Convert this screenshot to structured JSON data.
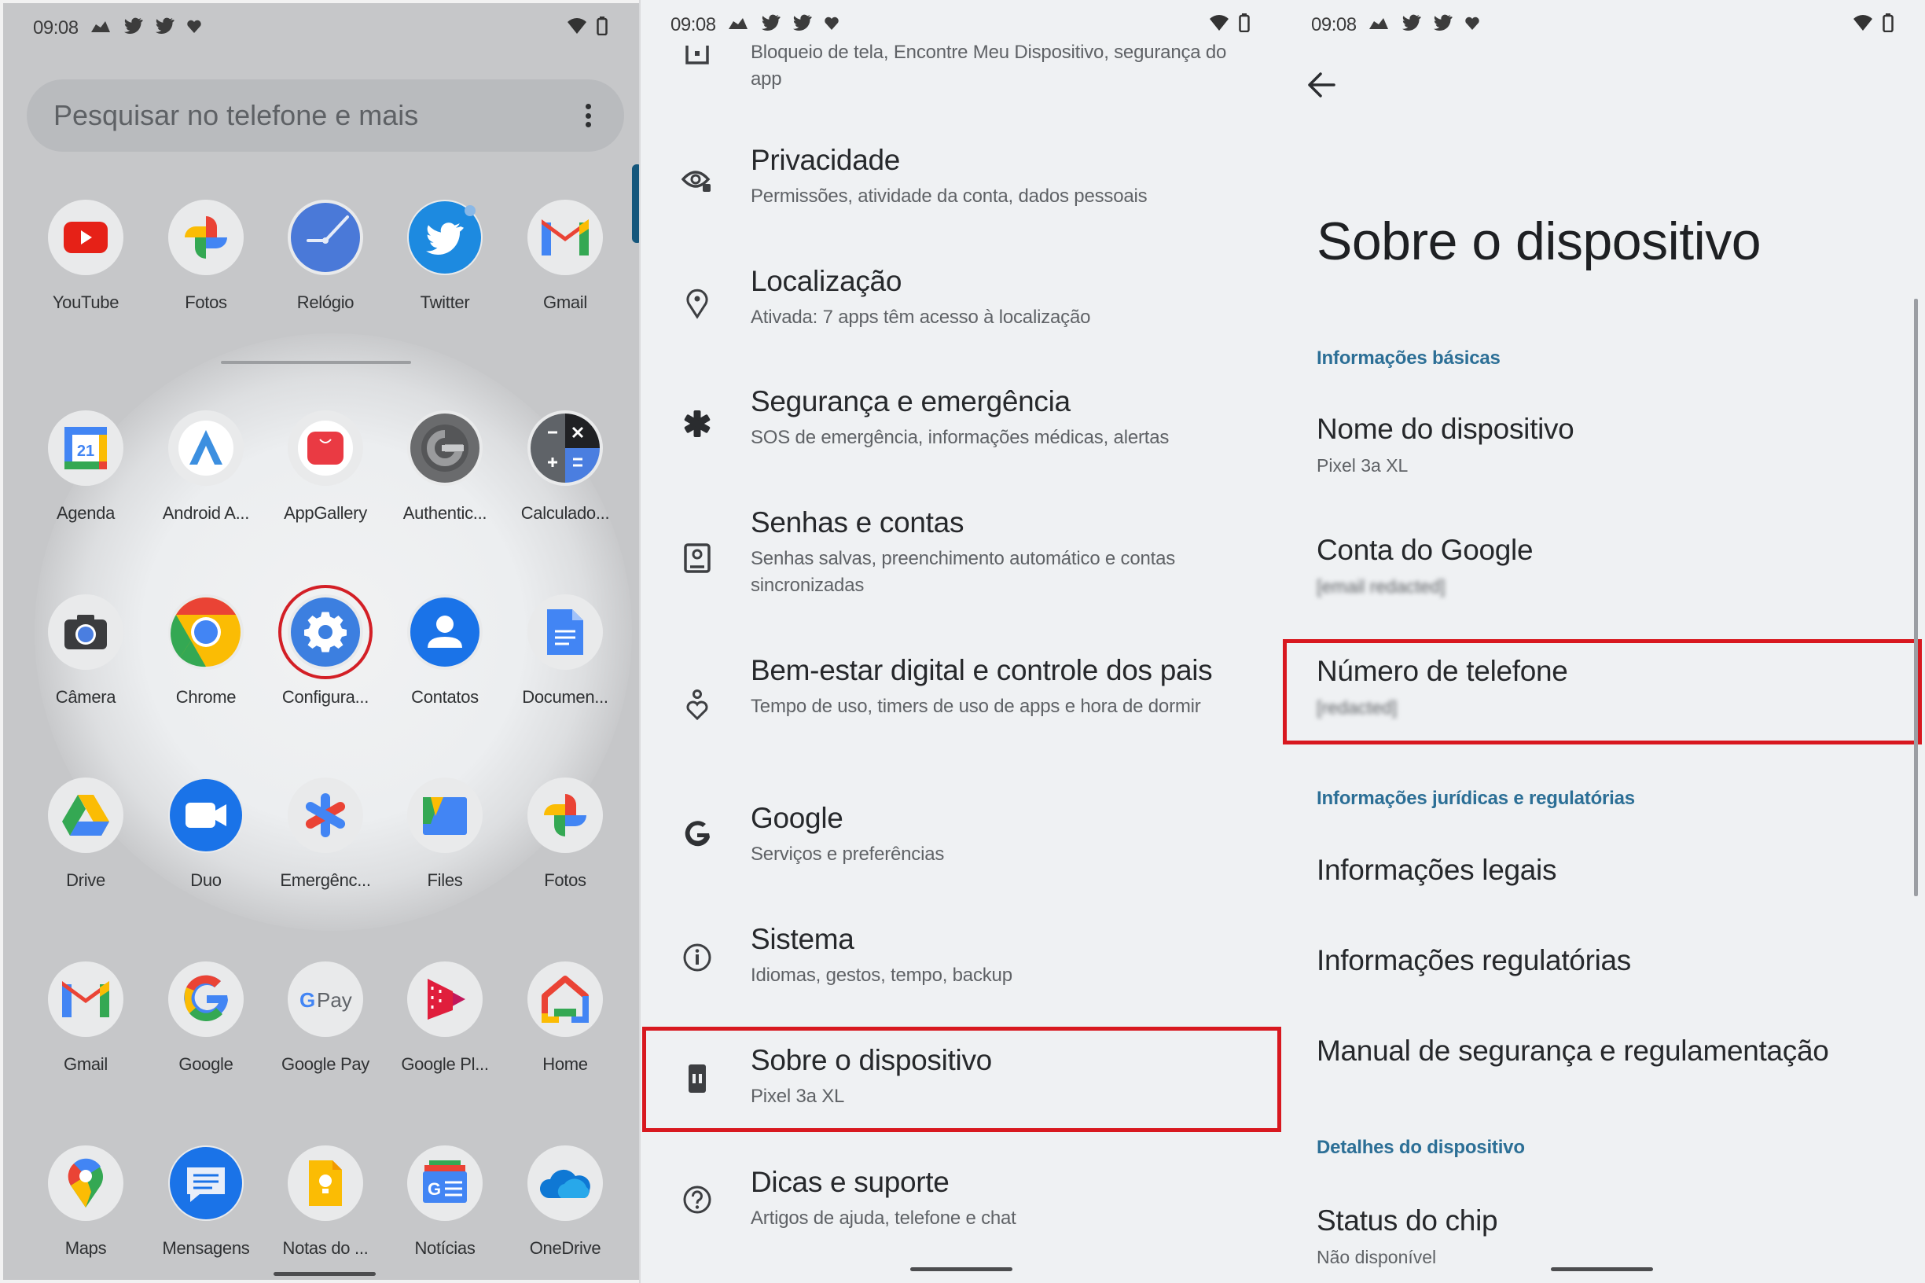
{
  "status_bar": {
    "time": "09:08",
    "icons": [
      "cloud-icon",
      "twitter-icon",
      "twitter-icon",
      "heart-shield-icon"
    ],
    "right_icons": [
      "wifi-icon",
      "battery-icon"
    ]
  },
  "drawer": {
    "search_placeholder": "Pesquisar no telefone e mais",
    "apps": [
      {
        "label": "YouTube",
        "icon": "youtube-icon"
      },
      {
        "label": "Fotos",
        "icon": "google-photos-icon"
      },
      {
        "label": "Relógio",
        "icon": "clock-icon"
      },
      {
        "label": "Twitter",
        "icon": "twitter-icon"
      },
      {
        "label": "Gmail",
        "icon": "gmail-icon"
      },
      {
        "label": "Agenda",
        "icon": "calendar-icon"
      },
      {
        "label": "Android A...",
        "icon": "android-auto-icon"
      },
      {
        "label": "AppGallery",
        "icon": "appgallery-icon"
      },
      {
        "label": "Authentic...",
        "icon": "authenticator-icon"
      },
      {
        "label": "Calculado...",
        "icon": "calculator-icon"
      },
      {
        "label": "Câmera",
        "icon": "camera-icon"
      },
      {
        "label": "Chrome",
        "icon": "chrome-icon"
      },
      {
        "label": "Configura...",
        "icon": "settings-gear-icon",
        "highlighted": true
      },
      {
        "label": "Contatos",
        "icon": "contacts-icon"
      },
      {
        "label": "Documen...",
        "icon": "docs-icon"
      },
      {
        "label": "Drive",
        "icon": "drive-icon"
      },
      {
        "label": "Duo",
        "icon": "duo-icon"
      },
      {
        "label": "Emergênc...",
        "icon": "emergency-icon"
      },
      {
        "label": "Files",
        "icon": "files-icon"
      },
      {
        "label": "Fotos",
        "icon": "google-photos-icon"
      },
      {
        "label": "Gmail",
        "icon": "gmail-icon"
      },
      {
        "label": "Google",
        "icon": "google-icon"
      },
      {
        "label": "Google Pay",
        "icon": "google-pay-icon"
      },
      {
        "label": "Google Pl...",
        "icon": "play-movies-icon"
      },
      {
        "label": "Home",
        "icon": "home-icon"
      },
      {
        "label": "Maps",
        "icon": "maps-icon"
      },
      {
        "label": "Mensagens",
        "icon": "messages-icon"
      },
      {
        "label": "Notas do ...",
        "icon": "keep-notes-icon"
      },
      {
        "label": "Notícias",
        "icon": "news-icon"
      },
      {
        "label": "OneDrive",
        "icon": "onedrive-icon"
      }
    ]
  },
  "settings": {
    "items": [
      {
        "title": "",
        "subtitle": "Bloqueio de tela, Encontre Meu Dispositivo, segurança do app",
        "icon": "security-lock-icon"
      },
      {
        "title": "Privacidade",
        "subtitle": "Permissões, atividade da conta, dados pessoais",
        "icon": "privacy-eye-icon"
      },
      {
        "title": "Localização",
        "subtitle": "Ativada: 7 apps têm acesso à localização",
        "icon": "location-pin-icon"
      },
      {
        "title": "Segurança e emergência",
        "subtitle": "SOS de emergência, informações médicas, alertas",
        "icon": "emergency-asterisk-icon"
      },
      {
        "title": "Senhas e contas",
        "subtitle": "Senhas salvas, preenchimento automático e contas sincronizadas",
        "icon": "account-box-icon"
      },
      {
        "title": "Bem-estar digital e controle dos pais",
        "subtitle": "Tempo de uso, timers de uso de apps e hora de dormir",
        "icon": "wellbeing-icon"
      },
      {
        "title": "Google",
        "subtitle": "Serviços e preferências",
        "icon": "google-g-icon"
      },
      {
        "title": "Sistema",
        "subtitle": "Idiomas, gestos, tempo, backup",
        "icon": "info-circle-icon"
      },
      {
        "title": "Sobre o dispositivo",
        "subtitle": "Pixel 3a XL",
        "icon": "phone-device-icon",
        "highlighted": true
      },
      {
        "title": "Dicas e suporte",
        "subtitle": "Artigos de ajuda, telefone e chat",
        "icon": "help-circle-icon"
      }
    ]
  },
  "about": {
    "title": "Sobre o dispositivo",
    "sections": [
      {
        "header": "Informações básicas"
      },
      {
        "header": "Informações jurídicas e regulatórias"
      },
      {
        "header": "Detalhes do dispositivo"
      }
    ],
    "items": [
      {
        "title": "Nome do dispositivo",
        "subtitle": "Pixel 3a XL"
      },
      {
        "title": "Conta do Google",
        "subtitle": "[email redacted]",
        "redacted": true
      },
      {
        "title": "Número de telefone",
        "subtitle": "[redacted]",
        "redacted": true,
        "highlighted": true
      },
      {
        "title": "Informações legais"
      },
      {
        "title": "Informações regulatórias"
      },
      {
        "title": "Manual de segurança e regulamentação"
      },
      {
        "title": "Status do chip",
        "subtitle": "Não disponível"
      }
    ]
  },
  "colors": {
    "highlight": "#d8181f",
    "section_header": "#2c6f96",
    "drawer_bg": "#c6c7c9",
    "settings_bg": "#eff1f3",
    "scrollbar_accent": "#15577c"
  }
}
